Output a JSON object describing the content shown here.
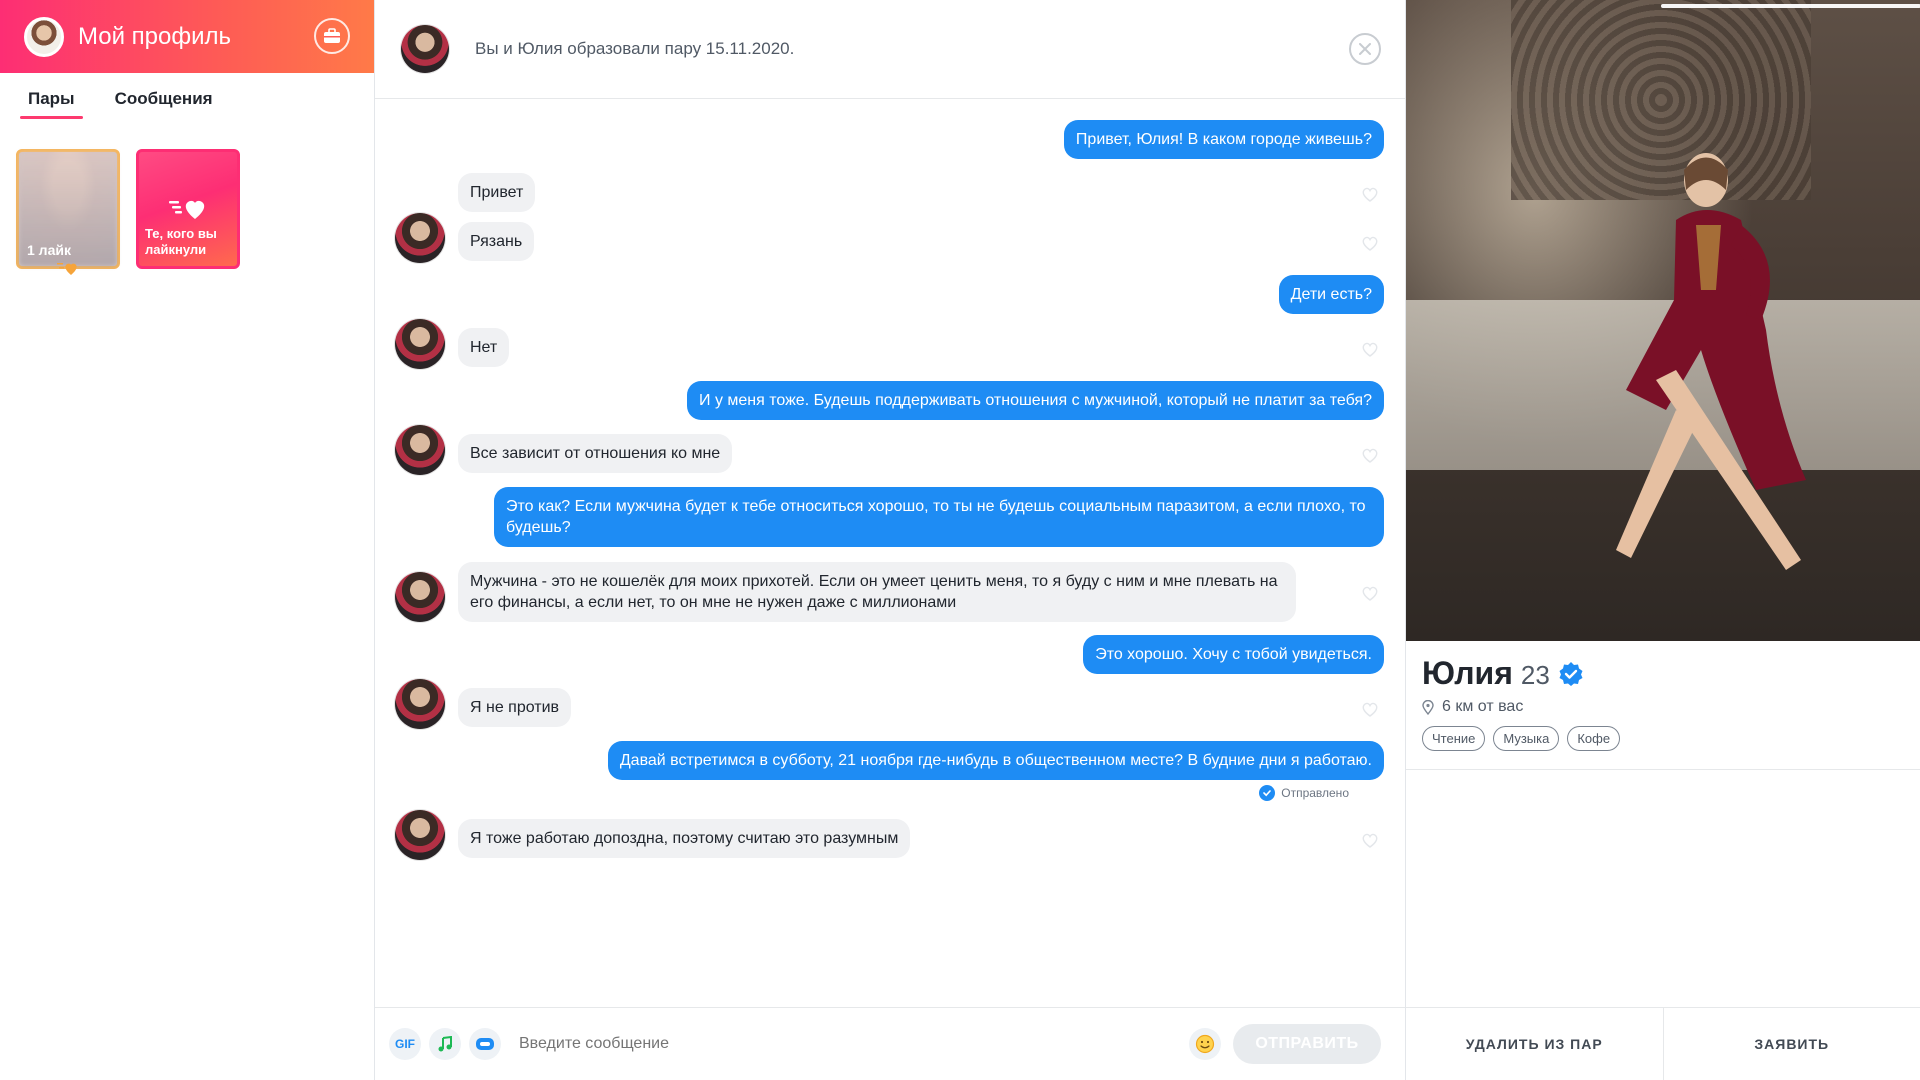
{
  "sidebar": {
    "title": "Мой профиль",
    "tabs": [
      {
        "label": "Пары"
      },
      {
        "label": "Сообщения"
      }
    ],
    "cards": {
      "likes_label": "1 лайк",
      "liked_label": "Те, кого вы лайкнули"
    }
  },
  "chat": {
    "header_text": "Вы и Юлия образовали пару 15.11.2020.",
    "messages": [
      {
        "dir": "out",
        "text": "Привет, Юлия! В каком городе живешь?"
      },
      {
        "dir": "in",
        "text": "Привет"
      },
      {
        "dir": "in",
        "text": "Рязань"
      },
      {
        "dir": "out",
        "text": "Дети есть?"
      },
      {
        "dir": "in",
        "text": "Нет"
      },
      {
        "dir": "out",
        "text": "И у меня тоже. Будешь поддерживать отношения с мужчиной, который не платит за тебя?"
      },
      {
        "dir": "in",
        "text": "Все зависит от отношения ко мне"
      },
      {
        "dir": "out",
        "text": "Это как? Если мужчина будет к тебе относиться хорошо, то ты не будешь социальным паразитом, а если плохо, то будешь?"
      },
      {
        "dir": "in",
        "text": "Мужчина - это не кошелёк для моих прихотей. Если он умеет ценить меня, то я буду с ним и мне плевать на его финансы, а если нет, то он мне не нужен даже с миллионами"
      },
      {
        "dir": "out",
        "text": "Это хорошо. Хочу с тобой увидеться."
      },
      {
        "dir": "in",
        "text": "Я не против"
      },
      {
        "dir": "out",
        "text": "Давай встретимся в субботу, 21 ноября где-нибудь в общественном месте? В будние дни я работаю."
      },
      {
        "dir": "in",
        "text": "Я тоже работаю допоздна, поэтому считаю это разумным"
      }
    ],
    "sent_status": "Отправлено",
    "composer": {
      "gif_label": "GIF",
      "placeholder": "Введите сообщение",
      "send_label": "ОТПРАВИТЬ"
    }
  },
  "profile": {
    "name": "Юлия",
    "age": "23",
    "distance": "6 км от вас",
    "tags": [
      "Чтение",
      "Музыка",
      "Кофе"
    ],
    "unmatch_label": "УДАЛИТЬ ИЗ ПАР",
    "report_label": "ЗАЯВИТЬ"
  },
  "colors": {
    "brand_gradient_start": "#fd2e74",
    "brand_gradient_end": "#ff7a48",
    "outgoing_bubble": "#1e8cf4",
    "incoming_bubble": "#f0f1f3"
  },
  "icons": [
    "briefcase-icon",
    "close-icon",
    "heart-icon",
    "gif-icon",
    "music-icon",
    "sticker-icon",
    "emoji-icon",
    "verified-icon",
    "location-pin-icon",
    "sent-check-icon"
  ]
}
